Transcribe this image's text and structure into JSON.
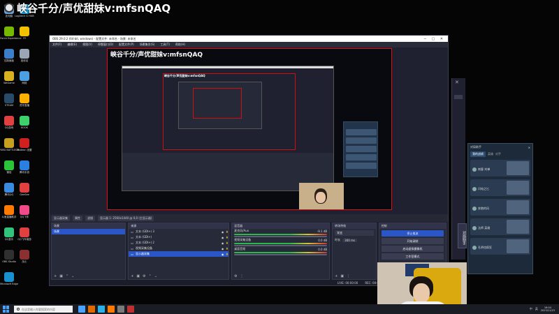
{
  "overlay": {
    "title": "峡谷千分/声优甜妹v:mfsnQAQ"
  },
  "desktop_icons": [
    {
      "label": "此电脑",
      "color": "#6aa0d8"
    },
    {
      "label": "Logitech G HUB",
      "color": "#1aa0e0"
    },
    {
      "label": "GeForce Experience",
      "color": "#76b900"
    },
    {
      "label": "YY",
      "color": "#f2c200"
    },
    {
      "label": "控制面板",
      "color": "#3a7fc8"
    },
    {
      "label": "回收站",
      "color": "#9aa5b5"
    },
    {
      "label": "WeGame",
      "color": "#d8b020"
    },
    {
      "label": "网络",
      "color": "#4aa0e0"
    },
    {
      "label": "STEAM",
      "color": "#2a4a6a"
    },
    {
      "label": "虎牙直播",
      "color": "#ffb000"
    },
    {
      "label": "QQ游戏",
      "color": "#e24040"
    },
    {
      "label": "KOOK",
      "color": "#3ed06a"
    },
    {
      "label": "PUBG BATTLEGR",
      "color": "#c8a020"
    },
    {
      "label": "Radeon 设置",
      "color": "#d02020"
    },
    {
      "label": "微信",
      "color": "#2ac43a"
    },
    {
      "label": "腾讯手游",
      "color": "#2a80e0"
    },
    {
      "label": "腾讯QQ",
      "color": "#3a8ae0"
    },
    {
      "label": "GeeSee",
      "color": "#e04040"
    },
    {
      "label": "斗鱼直播助手",
      "color": "#ff7a00"
    },
    {
      "label": "QQ飞车",
      "color": "#f04a8a"
    },
    {
      "label": "QQ音乐",
      "color": "#31c27c"
    },
    {
      "label": "QQ飞车端游",
      "color": "#e04040"
    },
    {
      "label": "OBS Studio",
      "color": "#303030"
    },
    {
      "label": "战士",
      "color": "#8a3030"
    },
    {
      "label": "Microsoft Edge",
      "color": "#1a8fd0"
    }
  ],
  "obs": {
    "title": "OBS 29.0.2 (64-bit, windows) - 配置文件: 未命名 - 场景: 未命名",
    "menu": [
      "文件(F)",
      "编辑(E)",
      "视图(V)",
      "停靠窗口(D)",
      "配置文件(P)",
      "场景集合(S)",
      "工具(T)",
      "帮助(H)"
    ],
    "preview_title": "峡谷千分/声优甜妹v:mfsnQAQ",
    "nested_title": "峡谷千分/声优甜妹v:mfsnQAQ",
    "toolbar": [
      "显示器采集",
      "属性",
      "滤镜",
      "显示器  1: 2560x1440 @ 0,0 (主显示器)"
    ],
    "docks": {
      "scenes": {
        "title": "场景",
        "items": [
          "场景"
        ]
      },
      "sources": {
        "title": "来源",
        "items": [
          "文本 (GDI+) 3",
          "文本 (GDI+)",
          "文本 (GDI+) 2",
          "视频采集设备",
          "显示器采集"
        ]
      },
      "mixer": {
        "title": "混音器",
        "tracks": [
          {
            "name": "麦克风/Aux",
            "db": "-9.1 dB"
          },
          {
            "name": "视频采集设备",
            "db": "0.0 dB"
          },
          {
            "name": "桌面音频",
            "db": "0.0 dB"
          }
        ]
      },
      "transitions": {
        "title": "转场特效",
        "type": "渐变",
        "duration_label": "时长",
        "duration": "300 ms"
      },
      "controls": {
        "title": "控制",
        "buttons": [
          "停止推流",
          "开始录制",
          "启动虚拟摄像机",
          "工作室模式"
        ]
      }
    },
    "status": {
      "live": "LIVE: 00:00:00",
      "rec": "REC: 00:00:00"
    }
  },
  "side_panel": {
    "vtab": "对局助手"
  },
  "assistant": {
    "title": "对局助手",
    "tabs": [
      "我的战绩",
      "英雄",
      "对手"
    ],
    "cards": [
      {
        "name": "刺客 刘禅",
        "meta": "王者 45星 · 对局 · 胜率"
      },
      {
        "name": "闪电之匕",
        "meta": "星耀 · 近期对局"
      },
      {
        "name": "奔跑的风",
        "meta": "钻石 · 对局 · 胜率"
      },
      {
        "name": "法师 英雄",
        "meta": "王者 · 对局"
      },
      {
        "name": "孔明也疯狂",
        "meta": "星耀 · 近期对局"
      }
    ]
  },
  "taskbar": {
    "search_placeholder": "在这里输入你要搜索的内容",
    "apps": [
      {
        "color": "#4aa3ff"
      },
      {
        "color": "#e06a00"
      },
      {
        "color": "#2bb0e8"
      },
      {
        "color": "#ff7a00"
      },
      {
        "color": "#7a7a7a"
      },
      {
        "color": "#c03030"
      }
    ],
    "tray": [
      "中",
      "英"
    ],
    "time": "16:04",
    "date": "2023/11/23"
  }
}
